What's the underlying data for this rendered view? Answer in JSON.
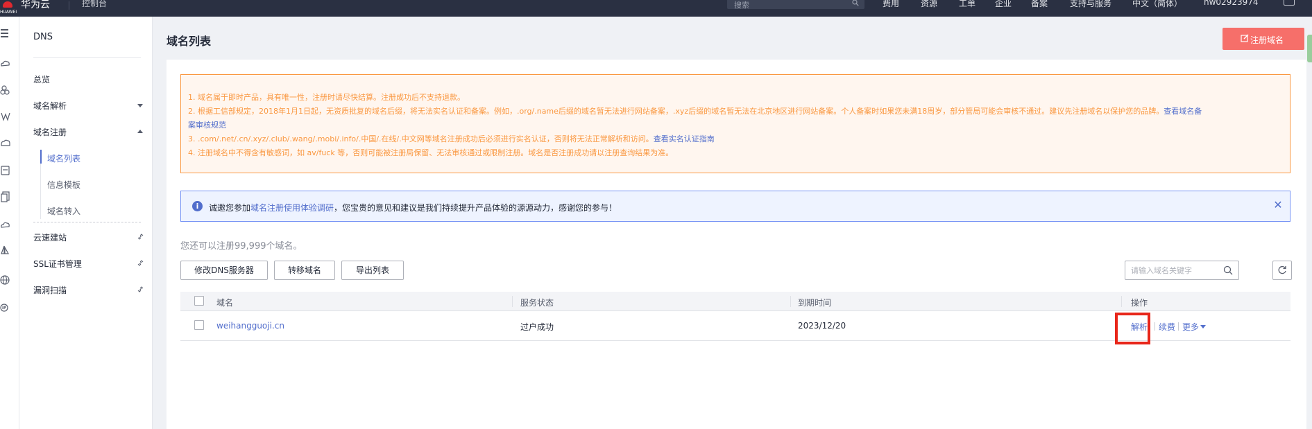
{
  "topbar": {
    "brand": "华为云",
    "logo_text": "HUAWEI",
    "console": "控制台",
    "search_placeholder": "搜索",
    "nav": [
      "费用",
      "资源",
      "工单",
      "企业",
      "备案",
      "支持与服务",
      "中文（简体）",
      "hw02923974"
    ]
  },
  "sidebar": {
    "title": "DNS",
    "items": [
      {
        "label": "总览"
      },
      {
        "label": "域名解析"
      },
      {
        "label": "域名注册"
      },
      {
        "label": "域名列表"
      },
      {
        "label": "信息模板"
      },
      {
        "label": "域名转入"
      },
      {
        "label": "云速建站"
      },
      {
        "label": "SSL证书管理"
      },
      {
        "label": "漏洞扫描"
      }
    ]
  },
  "page": {
    "title": "域名列表",
    "register_button": "注册域名"
  },
  "notice": {
    "line1": "1. 域名属于即时产品，具有唯一性，注册时请尽快结算。注册成功后不支持退款。",
    "line2_a": "2. 根据工信部规定，2018年1月1日起，无资质批复的域名后缀，将无法实名认证和备案。例如，.org/.name后缀的域名暂无法进行网站备案，.xyz后缀的域名暂无法在北京地区进行网站备案。个人备案时如果您未满18周岁，部分管局可能会审核不通过。建议先注册域名以保护您的品牌。",
    "line2_link1": "查看域名备",
    "line2_link2": "案审核规范",
    "line3_a": "3. .com/.net/.cn/.xyz/.club/.wang/.mobi/.info/.中国/.在线/.中文网等域名注册成功后必须进行实名认证，否则将无法正常解析和访问。",
    "line3_link": "查看实名认证指南",
    "line4": "4. 注册域名中不得含有敏感词，如 av/fuck 等，否则可能被注册局保留、无法审核通过或限制注册。域名是否注册成功请以注册查询结果为准。"
  },
  "survey": {
    "prefix": "诚邀您参加",
    "link": "域名注册使用体验调研",
    "suffix": "，您宝贵的意见和建议是我们持续提升产品体验的源源动力，感谢您的参与！",
    "info_glyph": "i",
    "close_glyph": "✕"
  },
  "quota_text": "您还可以注册99,999个域名。",
  "toolbar": {
    "modify_dns": "修改DNS服务器",
    "transfer": "转移域名",
    "export": "导出列表",
    "filter_placeholder": "请输入域名关键字"
  },
  "table": {
    "columns": [
      "域名",
      "服务状态",
      "到期时间",
      "操作"
    ],
    "rows": [
      {
        "domain": "weihangguoji.cn",
        "status": "过户成功",
        "expiry": "2023/12/20",
        "actions": [
          "解析",
          "续费",
          "更多"
        ]
      }
    ]
  },
  "colors": {
    "primary": "#526ecc",
    "warning": "#fa9841",
    "danger_button": "#f66f6a",
    "highlight": "#e8261a",
    "topbar": "#2a3042"
  }
}
